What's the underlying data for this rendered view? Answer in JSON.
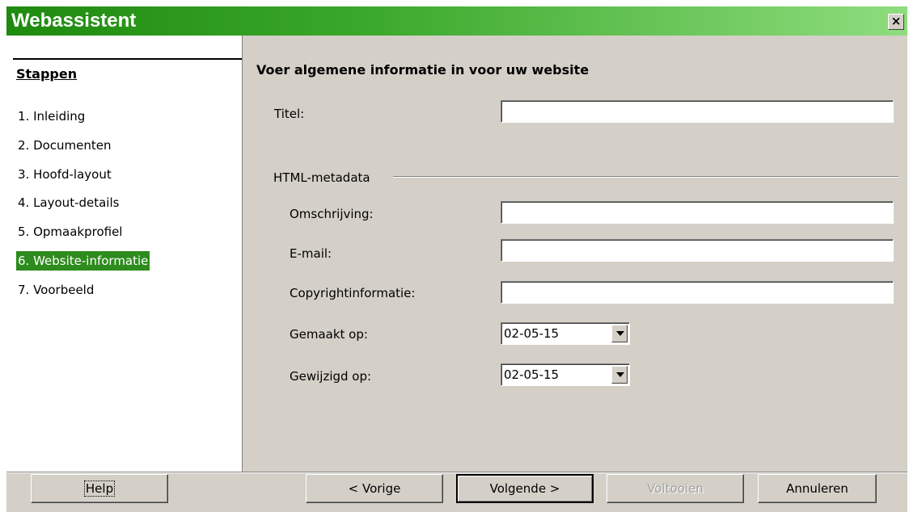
{
  "window": {
    "title": "Webassistent",
    "close_label": "×"
  },
  "sidebar": {
    "heading": "Stappen",
    "steps": [
      "1. Inleiding",
      "2. Documenten",
      "3. Hoofd-layout",
      "4. Layout-details",
      "5. Opmaakprofiel",
      "6. Website-informatie",
      "7. Voorbeeld"
    ],
    "active_index": 5,
    "active_color": "#2e8b1e"
  },
  "main": {
    "title": "Voer algemene informatie in voor uw website",
    "titel_label": "Titel:",
    "titel_value": "",
    "group_label": "HTML-metadata",
    "omschrijving_label": "Omschrijving:",
    "omschrijving_value": "",
    "email_label": "E-mail:",
    "email_value": "",
    "copyright_label": "Copyrightinformatie:",
    "copyright_value": "",
    "gemaakt_label": "Gemaakt op:",
    "gemaakt_value": "02-05-15",
    "gewijzigd_label": "Gewijzigd op:",
    "gewijzigd_value": "02-05-15"
  },
  "buttons": {
    "help": "Help",
    "previous": "< Vorige",
    "next": "Volgende >",
    "finish": "Voltooien",
    "cancel": "Annuleren"
  },
  "colors": {
    "title_gradient_start": "#1e8a0f",
    "title_gradient_end": "#8fdd7e",
    "face": "#d4d0c8"
  }
}
